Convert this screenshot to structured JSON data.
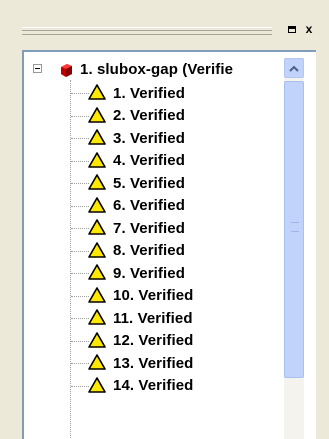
{
  "panel": {
    "restore_button": "□",
    "close_button": "x"
  },
  "tree": {
    "root": {
      "label": "1. slubox-gap (Verifie",
      "icon": "red-cube-icon",
      "expanded": true
    },
    "children": [
      {
        "label": "1. Verified",
        "icon": "warning-triangle-icon"
      },
      {
        "label": "2. Verified",
        "icon": "warning-triangle-icon"
      },
      {
        "label": "3. Verified",
        "icon": "warning-triangle-icon"
      },
      {
        "label": "4. Verified",
        "icon": "warning-triangle-icon"
      },
      {
        "label": "5. Verified",
        "icon": "warning-triangle-icon"
      },
      {
        "label": "6. Verified",
        "icon": "warning-triangle-icon"
      },
      {
        "label": "7. Verified",
        "icon": "warning-triangle-icon"
      },
      {
        "label": "8. Verified",
        "icon": "warning-triangle-icon"
      },
      {
        "label": "9. Verified",
        "icon": "warning-triangle-icon"
      },
      {
        "label": "10. Verified",
        "icon": "warning-triangle-icon"
      },
      {
        "label": "11. Verified",
        "icon": "warning-triangle-icon"
      },
      {
        "label": "12. Verified",
        "icon": "warning-triangle-icon"
      },
      {
        "label": "13. Verified",
        "icon": "warning-triangle-icon"
      },
      {
        "label": "14. Verified",
        "icon": "warning-triangle-icon"
      }
    ]
  },
  "colors": {
    "panel_background": "#ece9d8",
    "tree_background": "#ffffff",
    "scrollbar_accent": "#c1d3fb",
    "warning_yellow": "#ffe800",
    "root_icon_red": "#d00000"
  }
}
